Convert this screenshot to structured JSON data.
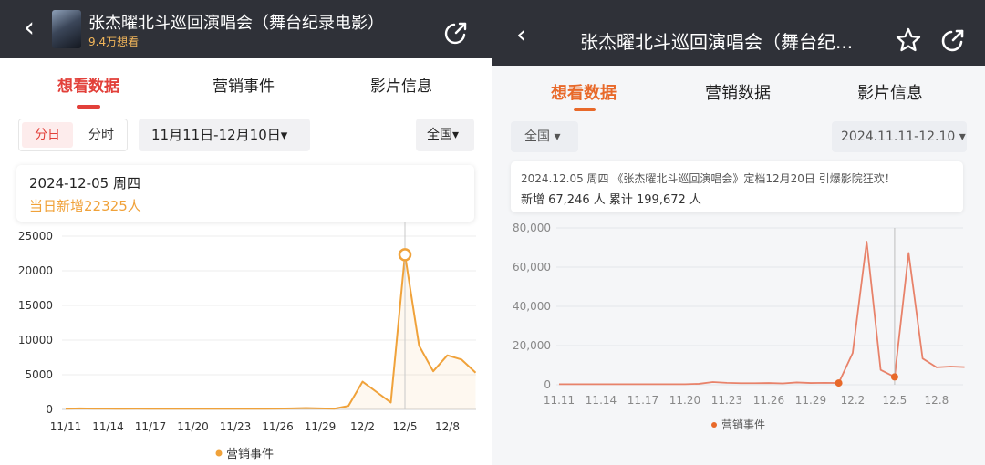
{
  "left": {
    "header": {
      "title": "张杰曜北斗巡回演唱会（舞台纪录电影）",
      "subtitle": "9.4万想看"
    },
    "tabs": [
      {
        "label": "想看数据",
        "active": true
      },
      {
        "label": "营销事件",
        "active": false
      },
      {
        "label": "影片信息",
        "active": false
      }
    ],
    "granularity": {
      "day": "分日",
      "hour": "分时",
      "selected": "分日"
    },
    "date_range": "11月11日-12月10日▾",
    "region": "全国▾",
    "tooltip": {
      "date": "2024-12-05  周四",
      "new_label": "当日新增",
      "new_value": "22325",
      "unit": "人"
    },
    "legend": "营销事件",
    "colors": {
      "accent": "#e2403a",
      "line": "#f0a23a",
      "header": "#2f3138"
    }
  },
  "right": {
    "header": {
      "title": "张杰曜北斗巡回演唱会（舞台纪..."
    },
    "tabs": [
      {
        "label": "想看数据",
        "active": true
      },
      {
        "label": "营销数据",
        "active": false
      },
      {
        "label": "影片信息",
        "active": false
      }
    ],
    "region": "全国 ▾",
    "date_range": "2024.11.11-12.10 ▾",
    "tooltip": {
      "line1": "2024.12.05 周四 《张杰曜北斗巡回演唱会》定档12月20日 引爆影院狂欢！",
      "line2": "新增 67,246 人   累计 199,672 人"
    },
    "legend": "营销事件",
    "colors": {
      "accent": "#e8692a",
      "line": "#e8826a"
    }
  },
  "chart_data": [
    {
      "type": "area",
      "title": "",
      "x_ticks": [
        "11/11",
        "11/14",
        "11/17",
        "11/20",
        "11/23",
        "11/26",
        "11/29",
        "12/2",
        "12/5",
        "12/8"
      ],
      "y_ticks": [
        "0",
        "5000",
        "10000",
        "15000",
        "20000",
        "25000"
      ],
      "ylim": [
        0,
        25000
      ],
      "x": [
        "11/11",
        "11/12",
        "11/13",
        "11/14",
        "11/15",
        "11/16",
        "11/17",
        "11/18",
        "11/19",
        "11/20",
        "11/21",
        "11/22",
        "11/23",
        "11/24",
        "11/25",
        "11/26",
        "11/27",
        "11/28",
        "11/29",
        "11/30",
        "12/1",
        "12/2",
        "12/3",
        "12/4",
        "12/5",
        "12/6",
        "12/7",
        "12/8",
        "12/9",
        "12/10"
      ],
      "series": [
        {
          "values": [
            100,
            150,
            120,
            110,
            100,
            110,
            100,
            100,
            100,
            100,
            100,
            100,
            100,
            100,
            100,
            120,
            150,
            200,
            150,
            100,
            500,
            4000,
            2500,
            1000,
            22325,
            9200,
            5500,
            7800,
            7200,
            5300
          ]
        }
      ],
      "highlight": {
        "x": "12/5",
        "value": 22325
      },
      "grid": true
    },
    {
      "type": "line",
      "title": "",
      "x_ticks": [
        "11.11",
        "11.14",
        "11.17",
        "11.20",
        "11.23",
        "11.26",
        "11.29",
        "12.2",
        "12.5",
        "12.8"
      ],
      "y_ticks": [
        "0",
        "20,000",
        "40,000",
        "60,000",
        "80,000"
      ],
      "ylim": [
        0,
        80000
      ],
      "x": [
        "11.11",
        "11.12",
        "11.13",
        "11.14",
        "11.15",
        "11.16",
        "11.17",
        "11.18",
        "11.19",
        "11.20",
        "11.21",
        "11.22",
        "11.23",
        "11.24",
        "11.25",
        "11.26",
        "11.27",
        "11.28",
        "11.29",
        "11.30",
        "12.1",
        "12.2",
        "12.3",
        "12.4",
        "12.5",
        "12.6",
        "12.7",
        "12.8",
        "12.9",
        "12.10"
      ],
      "series": [
        {
          "values": [
            300,
            300,
            300,
            300,
            300,
            300,
            300,
            300,
            300,
            300,
            500,
            1400,
            1000,
            800,
            800,
            900,
            700,
            1200,
            900,
            1000,
            900,
            16200,
            73000,
            7600,
            4000,
            67246,
            13400,
            8900,
            9300,
            9000,
            5800
          ]
        }
      ],
      "event_points": [
        "12.1",
        "12.5"
      ],
      "grid": true
    }
  ]
}
